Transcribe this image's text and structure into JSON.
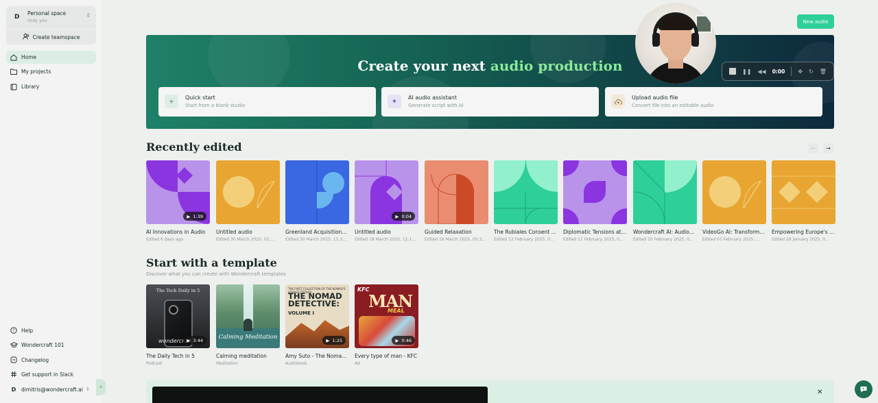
{
  "sidebar": {
    "space": {
      "initial": "D",
      "title": "Personal space",
      "subtitle": "Only you"
    },
    "create_teamspace": "Create teamspace",
    "nav": [
      {
        "label": "Home",
        "icon": "home-icon",
        "active": true
      },
      {
        "label": "My projects",
        "icon": "folder-icon",
        "active": false
      },
      {
        "label": "Library",
        "icon": "library-icon",
        "active": false
      }
    ],
    "footer": [
      {
        "label": "Help",
        "icon": "help-icon"
      },
      {
        "label": "Wondercraft 101",
        "icon": "graduation-icon"
      },
      {
        "label": "Changelog",
        "icon": "changelog-icon"
      },
      {
        "label": "Get support in Slack",
        "icon": "slack-icon"
      }
    ],
    "user": {
      "initial": "D",
      "email": "dimitris@wondercraft.ai"
    }
  },
  "header": {
    "new_audio": "New audio"
  },
  "hero": {
    "title_plain": "Create your next ",
    "title_accent": "audio production",
    "cards": [
      {
        "title": "Quick start",
        "subtitle": "Start from a blank studio",
        "icon": "plus-icon"
      },
      {
        "title": "AI audio assistant",
        "subtitle": "Generate script with AI",
        "icon": "sparkle-icon"
      },
      {
        "title": "Upload audio file",
        "subtitle": "Convert file into an editable audio",
        "icon": "cloud-upload-icon"
      }
    ]
  },
  "recorder": {
    "time": "0:00"
  },
  "recent": {
    "title": "Recently edited",
    "items": [
      {
        "title": "AI Innovations in Audio",
        "edited": "Edited 6 days ago",
        "duration": "1:39"
      },
      {
        "title": "Untitled audio",
        "edited": "Edited 30 March 2025, 02:...",
        "duration": ""
      },
      {
        "title": "Greenland Acquisition...",
        "edited": "Edited 30 March 2025, 11:3...",
        "duration": ""
      },
      {
        "title": "Untitled audio",
        "edited": "Edited 18 March 2025, 12:19 ...",
        "duration": "0:04"
      },
      {
        "title": "Guided Relaxation",
        "edited": "Edited 16 March 2025, 05:3...",
        "duration": ""
      },
      {
        "title": "The Rubiales Consent ...",
        "edited": "Edited 12 February 2025, 0...",
        "duration": ""
      },
      {
        "title": "Diplomatic Tensions at...",
        "edited": "Edited 11 February 2025, 0...",
        "duration": ""
      },
      {
        "title": "Wondercraft AI: Audio...",
        "edited": "Edited 10 February 2025, 0...",
        "duration": ""
      },
      {
        "title": "VideoGo AI: Transform...",
        "edited": "Edited 07 February 2025, ...",
        "duration": ""
      },
      {
        "title": "Empowering Europe's ...",
        "edited": "Edited 28 January 2025, 0...",
        "duration": ""
      }
    ]
  },
  "templates": {
    "title": "Start with a template",
    "subtitle": "Discover what you can create with Wondercraft templates",
    "items": [
      {
        "title": "The Daily Tech in 5",
        "category": "Podcast",
        "duration": "3:44",
        "art_title": "The Tech Daily in 5",
        "art_logo": "wondercraft"
      },
      {
        "title": "Calming meditation",
        "category": "Meditation",
        "duration": "",
        "art_title": "Calming Meditation"
      },
      {
        "title": "Amy Suto - The Noma...",
        "category": "Audiobook",
        "duration": "1:25",
        "art_head": "THE FIRST COLLECTION OF THE NOMAD'S VOYAGE STORIES",
        "art_title": "THE NOMAD DETECTIVE:",
        "art_vol": "VOLUME I",
        "art_author": "AMY SUTO"
      },
      {
        "title": "Every type of man - KFC",
        "category": "Ad",
        "duration": "0:46",
        "art_kfc": "KFC",
        "art_top": "FULLY LOADED",
        "art_title": "MAN",
        "art_meal": "MEAL"
      }
    ]
  },
  "colors": {
    "accent": "#2fcf9a",
    "hero_accent": "#8ce99a",
    "purple": "#b88ee6",
    "orange": "#e8a531",
    "blue": "#3a68e2",
    "salmon": "#e98c70",
    "teal": "#2fcf9a"
  }
}
